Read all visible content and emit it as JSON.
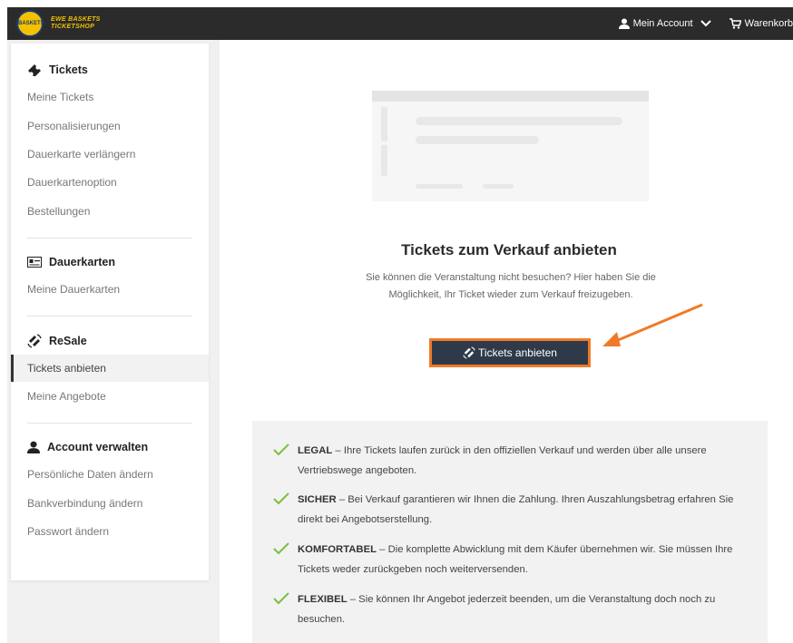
{
  "brand": {
    "badge_text": "BASKETS",
    "line1": "EWE BASKETS",
    "line2": "TICKETSHOP"
  },
  "topnav": {
    "account": "Mein Account",
    "cart": "Warenkorb"
  },
  "sidebar": {
    "tickets": {
      "title": "Tickets",
      "items": [
        "Meine Tickets",
        "Personalisierungen",
        "Dauerkarte verlängern",
        "Dauerkartenoption",
        "Bestellungen"
      ]
    },
    "dauerkarten": {
      "title": "Dauerkarten",
      "items": [
        "Meine Dauerkarten"
      ]
    },
    "resale": {
      "title": "ReSale",
      "items": [
        "Tickets anbieten",
        "Meine Angebote"
      ],
      "active": "Tickets anbieten"
    },
    "account": {
      "title": "Account verwalten",
      "items": [
        "Persönliche Daten ändern",
        "Bankverbindung ändern",
        "Passwort ändern"
      ]
    }
  },
  "main": {
    "title": "Tickets zum Verkauf anbieten",
    "subtitle": "Sie können die Veranstaltung nicht besuchen? Hier haben Sie die Möglichkeit, Ihr Ticket wieder zum Verkauf freizugeben.",
    "cta": "Tickets anbieten",
    "accent_color": "#f07a28",
    "benefits": [
      {
        "label": "LEGAL",
        "text": "Ihre Tickets laufen zurück in den offiziellen Verkauf und werden über alle unsere Vertriebswege angeboten."
      },
      {
        "label": "SICHER",
        "text": "Bei Verkauf garantieren wir Ihnen die Zahlung. Ihren Auszahlungsbetrag erfahren Sie direkt bei Angebotserstellung."
      },
      {
        "label": "KOMFORTABEL",
        "text": "Die komplette Abwicklung mit dem Käufer übernehmen wir. Sie müssen Ihre Tickets weder zurückgeben noch weiterversenden."
      },
      {
        "label": "FLEXIBEL",
        "text": "Sie können Ihr Angebot jederzeit beenden, um die Veranstaltung doch noch zu besuchen."
      }
    ]
  }
}
